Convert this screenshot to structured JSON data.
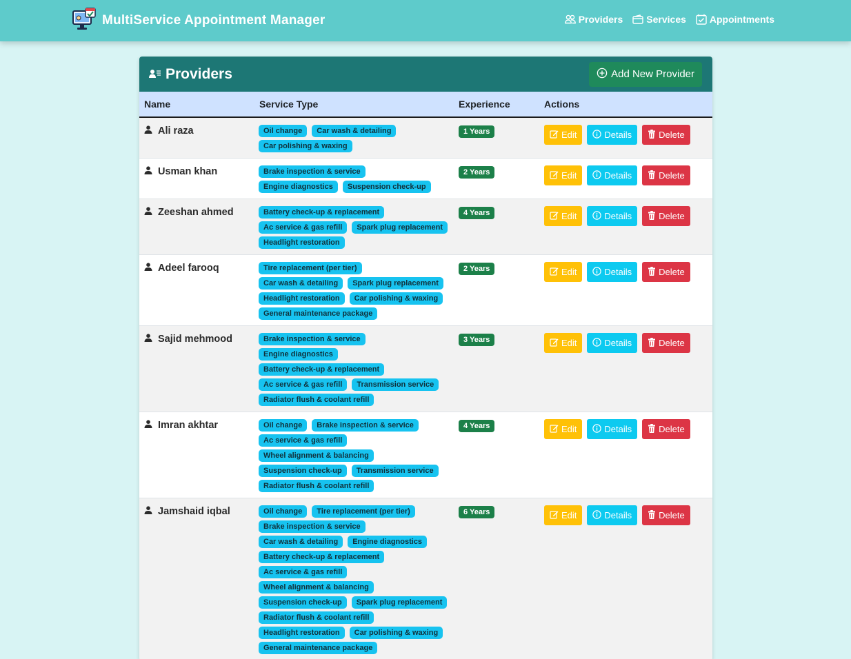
{
  "app": {
    "title": "MultiService Appointment Manager"
  },
  "nav": [
    {
      "label": "Providers",
      "icon": "people-icon"
    },
    {
      "label": "Services",
      "icon": "wallet-icon"
    },
    {
      "label": "Appointments",
      "icon": "calendar-check-icon"
    }
  ],
  "card": {
    "title": "Providers",
    "add_button": "Add New Provider"
  },
  "table": {
    "headers": {
      "name": "Name",
      "service": "Service Type",
      "experience": "Experience",
      "actions": "Actions"
    },
    "action_labels": {
      "edit": "Edit",
      "details": "Details",
      "delete": "Delete"
    },
    "rows": [
      {
        "name": "Ali raza",
        "services": [
          "Oil change",
          "Car wash & detailing",
          "Car polishing & waxing"
        ],
        "experience": "1 Years"
      },
      {
        "name": "Usman khan",
        "services": [
          "Brake inspection & service",
          "Engine diagnostics",
          "Suspension check-up"
        ],
        "experience": "2 Years"
      },
      {
        "name": "Zeeshan ahmed",
        "services": [
          "Battery check-up & replacement",
          "Ac service & gas refill",
          "Spark plug replacement",
          "Headlight restoration"
        ],
        "experience": "4 Years"
      },
      {
        "name": "Adeel farooq",
        "services": [
          "Tire replacement (per tier)",
          "Car wash & detailing",
          "Spark plug replacement",
          "Headlight restoration",
          "Car polishing & waxing",
          "General maintenance package"
        ],
        "experience": "2 Years"
      },
      {
        "name": "Sajid mehmood",
        "services": [
          "Brake inspection & service",
          "Engine diagnostics",
          "Battery check-up & replacement",
          "Ac service & gas refill",
          "Transmission service",
          "Radiator flush & coolant refill"
        ],
        "experience": "3 Years"
      },
      {
        "name": "Imran akhtar",
        "services": [
          "Oil change",
          "Brake inspection & service",
          "Ac service & gas refill",
          "Wheel alignment & balancing",
          "Suspension check-up",
          "Transmission service",
          "Radiator flush & coolant refill"
        ],
        "experience": "4 Years"
      },
      {
        "name": "Jamshaid iqbal",
        "services": [
          "Oil change",
          "Tire replacement (per tier)",
          "Brake inspection & service",
          "Car wash & detailing",
          "Engine diagnostics",
          "Battery check-up & replacement",
          "Ac service & gas refill",
          "Wheel alignment & balancing",
          "Suspension check-up",
          "Spark plug replacement",
          "Radiator flush & coolant refill",
          "Headlight restoration",
          "Car polishing & waxing",
          "General maintenance package"
        ],
        "experience": "6 Years"
      }
    ]
  },
  "colors": {
    "navbar": "#5ecbcb",
    "page_bg": "#d8f4f4",
    "card_header": "#1d7775",
    "add_button": "#1f8a5b",
    "table_header": "#cfe2ff",
    "service_tag": "#17c3f0",
    "experience_badge": "#1c8049",
    "edit": "#ffc107",
    "details": "#0dcaf0",
    "delete": "#dc3545"
  }
}
